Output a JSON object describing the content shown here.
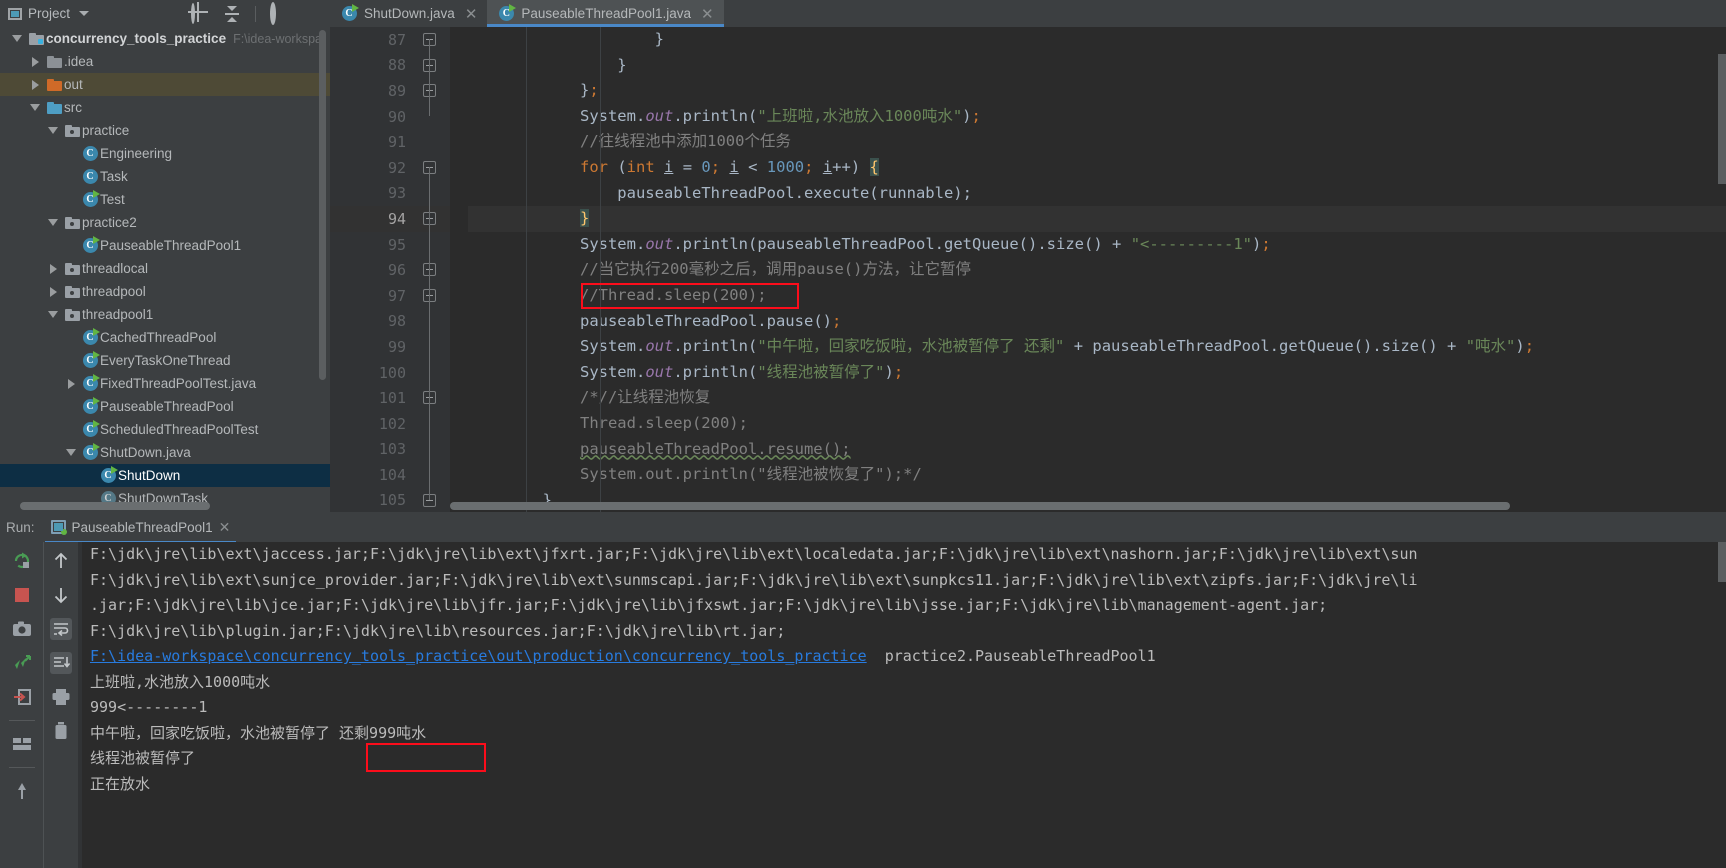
{
  "project_panel": {
    "title": "Project",
    "icons": [
      "window-icon",
      "chevron-down-icon",
      "target-icon",
      "collapse-all-icon",
      "gear-icon",
      "minimize-icon"
    ],
    "tree": [
      {
        "depth": 0,
        "arrow": "down",
        "icon": "project-module-icon",
        "label": "concurrency_tools_practice",
        "path": "F:\\idea-workspa",
        "bold": true,
        "state": "normal"
      },
      {
        "depth": 1,
        "arrow": "right",
        "icon": "folder-gray-icon",
        "label": ".idea",
        "path": "",
        "bold": false,
        "state": "normal"
      },
      {
        "depth": 1,
        "arrow": "right",
        "icon": "folder-orange-icon",
        "label": "out",
        "path": "",
        "bold": false,
        "state": "out"
      },
      {
        "depth": 1,
        "arrow": "down",
        "icon": "folder-blue-icon",
        "label": "src",
        "path": "",
        "bold": false,
        "state": "normal"
      },
      {
        "depth": 2,
        "arrow": "down",
        "icon": "package-icon",
        "label": "practice",
        "path": "",
        "bold": false,
        "state": "normal"
      },
      {
        "depth": 3,
        "arrow": "none",
        "icon": "class-icon",
        "label": "Engineering",
        "path": "",
        "bold": false,
        "state": "normal"
      },
      {
        "depth": 3,
        "arrow": "none",
        "icon": "class-icon",
        "label": "Task",
        "path": "",
        "bold": false,
        "state": "normal"
      },
      {
        "depth": 3,
        "arrow": "none",
        "icon": "runnable-class-icon",
        "label": "Test",
        "path": "",
        "bold": false,
        "state": "normal"
      },
      {
        "depth": 2,
        "arrow": "down",
        "icon": "package-icon",
        "label": "practice2",
        "path": "",
        "bold": false,
        "state": "normal"
      },
      {
        "depth": 3,
        "arrow": "none",
        "icon": "runnable-class-icon",
        "label": "PauseableThreadPool1",
        "path": "",
        "bold": false,
        "state": "normal"
      },
      {
        "depth": 2,
        "arrow": "right",
        "icon": "package-icon",
        "label": "threadlocal",
        "path": "",
        "bold": false,
        "state": "normal"
      },
      {
        "depth": 2,
        "arrow": "right",
        "icon": "package-icon",
        "label": "threadpool",
        "path": "",
        "bold": false,
        "state": "normal"
      },
      {
        "depth": 2,
        "arrow": "down",
        "icon": "package-icon",
        "label": "threadpool1",
        "path": "",
        "bold": false,
        "state": "normal"
      },
      {
        "depth": 3,
        "arrow": "none",
        "icon": "runnable-class-icon",
        "label": "CachedThreadPool",
        "path": "",
        "bold": false,
        "state": "normal"
      },
      {
        "depth": 3,
        "arrow": "none",
        "icon": "runnable-class-icon",
        "label": "EveryTaskOneThread",
        "path": "",
        "bold": false,
        "state": "normal"
      },
      {
        "depth": 3,
        "arrow": "right",
        "icon": "runnable-class-icon",
        "label": "FixedThreadPoolTest.java",
        "path": "",
        "bold": false,
        "state": "normal"
      },
      {
        "depth": 3,
        "arrow": "none",
        "icon": "runnable-class-icon",
        "label": "PauseableThreadPool",
        "path": "",
        "bold": false,
        "state": "normal"
      },
      {
        "depth": 3,
        "arrow": "none",
        "icon": "runnable-class-icon",
        "label": "ScheduledThreadPoolTest",
        "path": "",
        "bold": false,
        "state": "normal"
      },
      {
        "depth": 3,
        "arrow": "down",
        "icon": "runnable-class-icon",
        "label": "ShutDown.java",
        "path": "",
        "bold": false,
        "state": "normal"
      },
      {
        "depth": 4,
        "arrow": "none",
        "icon": "runnable-class-icon",
        "label": "ShutDown",
        "path": "",
        "bold": false,
        "state": "selected"
      },
      {
        "depth": 4,
        "arrow": "none",
        "icon": "class-icon-dim",
        "label": "ShutDownTask",
        "path": "",
        "bold": false,
        "state": "normal"
      }
    ]
  },
  "editor": {
    "tabs": [
      {
        "label": "ShutDown.java",
        "icon": "runnable-class-icon",
        "active": false,
        "closable": true
      },
      {
        "label": "PauseableThreadPool1.java",
        "icon": "runnable-class-icon",
        "active": true,
        "closable": true
      }
    ],
    "first_line_number": 87,
    "current_line": 94,
    "lines": [
      {
        "no": 87,
        "html": "                    }"
      },
      {
        "no": 88,
        "html": "                }"
      },
      {
        "no": 89,
        "html": "            }<span class=\"k\">;</span>"
      },
      {
        "no": 90,
        "html": "            System<span class=\"br\">.</span><span class=\"fld\">out</span><span class=\"br\">.</span>println<span class=\"br\">(</span><span class=\"s\">\"上班啦,水池放入1000吨水\"</span><span class=\"br\">)</span><span class=\"k\">;</span>"
      },
      {
        "no": 91,
        "html": "            <span class=\"c\">//往线程池中添加1000个任务</span>"
      },
      {
        "no": 92,
        "html": "            <span class=\"k\">for</span> <span class=\"br\">(</span><span class=\"k\">int</span> <span class=\"var\">i</span> <span class=\"br\">=</span> <span class=\"n\">0</span><span class=\"k\">;</span> <span class=\"var\">i</span> <span class=\"br\">&lt;</span> <span class=\"n\">1000</span><span class=\"k\">;</span> <span class=\"var\">i</span><span class=\"br\">++)</span> <span class=\"brh\">{</span>"
      },
      {
        "no": 93,
        "html": "                pauseableThreadPool<span class=\"br\">.</span>execute<span class=\"br\">(</span>runnable<span class=\"br\">);</span>"
      },
      {
        "no": 94,
        "html": "            <span class=\"brh\">}</span>"
      },
      {
        "no": 95,
        "html": "            System<span class=\"br\">.</span><span class=\"fld\">out</span><span class=\"br\">.</span>println<span class=\"br\">(</span>pauseableThreadPool<span class=\"br\">.</span>getQueue<span class=\"br\">().</span>size<span class=\"br\">()</span> <span class=\"br\">+</span> <span class=\"s\">\"&lt;---------1\"</span><span class=\"br\">)</span><span class=\"k\">;</span>"
      },
      {
        "no": 96,
        "html": "            <span class=\"c\">//当它执行200毫秒之后，调用pause()方法，让它暂停</span>"
      },
      {
        "no": 97,
        "html": "            <span class=\"c\">//Thread.sleep(200);</span>"
      },
      {
        "no": 98,
        "html": "            pauseableThreadPool<span class=\"br\">.</span>pause<span class=\"br\">()</span><span class=\"k\">;</span>"
      },
      {
        "no": 99,
        "html": "            System<span class=\"br\">.</span><span class=\"fld\">out</span><span class=\"br\">.</span>println<span class=\"br\">(</span><span class=\"s\">\"中午啦，回家吃饭啦，水池被暂停了 还剩\"</span> <span class=\"br\">+</span> pauseableThreadPool<span class=\"br\">.</span>getQueue<span class=\"br\">().</span>size<span class=\"br\">()</span> <span class=\"br\">+</span> <span class=\"s\">\"吨水\"</span><span class=\"br\">)</span><span class=\"k\">;</span>"
      },
      {
        "no": 100,
        "html": "            System<span class=\"br\">.</span><span class=\"fld\">out</span><span class=\"br\">.</span>println<span class=\"br\">(</span><span class=\"s\">\"线程池被暂停了\"</span><span class=\"br\">)</span><span class=\"k\">;</span>"
      },
      {
        "no": 101,
        "html": "            <span class=\"c\">/*//让线程池恢复</span>"
      },
      {
        "no": 102,
        "html": "            <span class=\"c\">Thread.sleep(200);</span>"
      },
      {
        "no": 103,
        "html": "            <span class=\"c warn\">pauseableThreadPool.resume();</span>"
      },
      {
        "no": 104,
        "html": "            <span class=\"c\">System.out.println(\"线程池被恢复了\");*/</span>"
      },
      {
        "no": 105,
        "html": "        }"
      }
    ],
    "highlight_box": {
      "line": 97,
      "text": "//Thread.sleep(200);",
      "color": "#fc0d1b"
    }
  },
  "run_panel": {
    "label": "Run:",
    "tab": {
      "label": "PauseableThreadPool1",
      "icon": "run-config-icon",
      "closable": true
    },
    "toolbar_left": [
      "rerun-icon",
      "stop-icon",
      "camera-icon",
      "thread-dump-icon",
      "export-icon",
      "layout-icon",
      "pin-icon"
    ],
    "toolbar_right": [
      "up-arrow-icon",
      "down-arrow-icon",
      "soft-wrap-icon",
      "scroll-to-end-icon",
      "print-icon",
      "trash-icon"
    ],
    "console_lines": [
      {
        "type": "text",
        "text": "F:\\jdk\\jre\\lib\\ext\\jaccess.jar;F:\\jdk\\jre\\lib\\ext\\jfxrt.jar;F:\\jdk\\jre\\lib\\ext\\localedata.jar;F:\\jdk\\jre\\lib\\ext\\nashorn.jar;F:\\jdk\\jre\\lib\\ext\\sun"
      },
      {
        "type": "text",
        "text": "F:\\jdk\\jre\\lib\\ext\\sunjce_provider.jar;F:\\jdk\\jre\\lib\\ext\\sunmscapi.jar;F:\\jdk\\jre\\lib\\ext\\sunpkcs11.jar;F:\\jdk\\jre\\lib\\ext\\zipfs.jar;F:\\jdk\\jre\\li"
      },
      {
        "type": "text",
        "text": ".jar;F:\\jdk\\jre\\lib\\jce.jar;F:\\jdk\\jre\\lib\\jfr.jar;F:\\jdk\\jre\\lib\\jfxswt.jar;F:\\jdk\\jre\\lib\\jsse.jar;F:\\jdk\\jre\\lib\\management-agent.jar;"
      },
      {
        "type": "text",
        "text": "F:\\jdk\\jre\\lib\\plugin.jar;F:\\jdk\\jre\\lib\\resources.jar;F:\\jdk\\jre\\lib\\rt.jar;"
      },
      {
        "type": "link_then_text",
        "link": "F:\\idea-workspace\\concurrency_tools_practice\\out\\production\\concurrency_tools_practice",
        "text": "  practice2.PauseableThreadPool1"
      },
      {
        "type": "text",
        "text": "上班啦,水池放入1000吨水"
      },
      {
        "type": "text",
        "text": "999<--------1"
      },
      {
        "type": "text",
        "text": "中午啦，回家吃饭啦，水池被暂停了 还剩999吨水"
      },
      {
        "type": "text",
        "text": "线程池被暂停了"
      },
      {
        "type": "text",
        "text": "正在放水"
      }
    ],
    "highlight_box": {
      "line_index": 7,
      "text": "还剩999吨水",
      "color": "#fc0d1b"
    }
  }
}
